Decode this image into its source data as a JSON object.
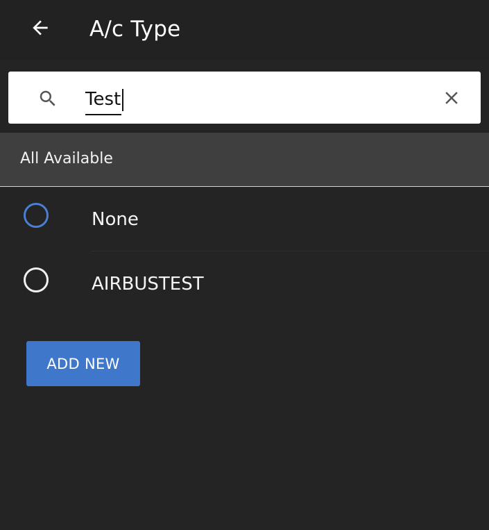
{
  "appbar": {
    "back_icon": "arrow-left-icon",
    "title": "A/c Type"
  },
  "search": {
    "icon": "search-icon",
    "value": "Test",
    "clear_icon": "close-icon"
  },
  "section": {
    "label": "All Available"
  },
  "options": [
    {
      "label": "None",
      "radio_color": "#4a7fd3"
    },
    {
      "label": "AIRBUSTEST",
      "radio_color": "#f1f1f1"
    }
  ],
  "actions": {
    "add_new_label": "ADD NEW"
  },
  "colors": {
    "background": "#242424",
    "accent": "#3f77cb",
    "section_header": "#3f3f3f"
  }
}
